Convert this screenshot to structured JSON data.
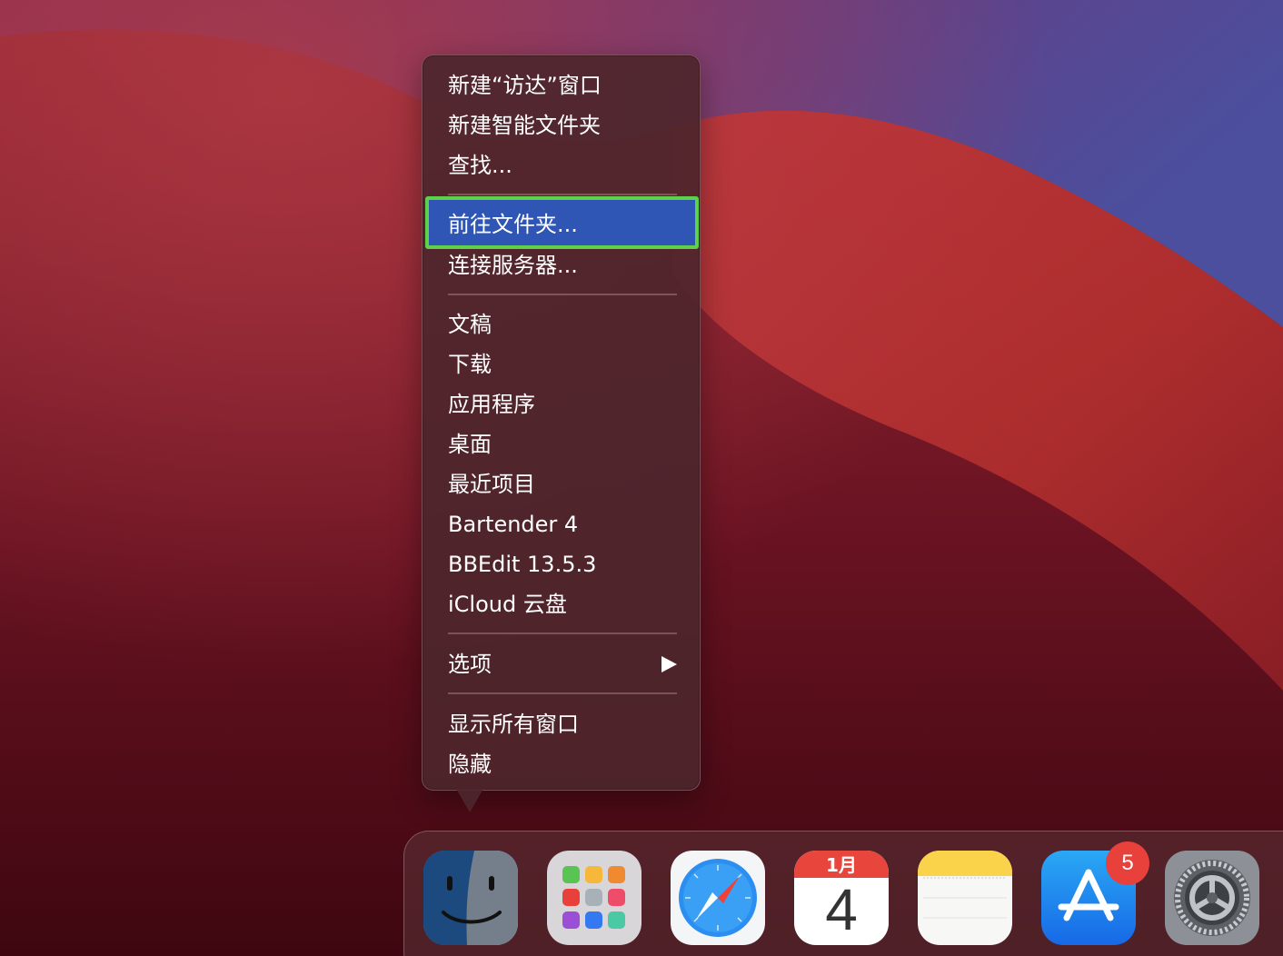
{
  "context_menu": {
    "items": [
      {
        "label": "新建“访达”窗口"
      },
      {
        "label": "新建智能文件夹"
      },
      {
        "label": "查找..."
      },
      {
        "label": "前往文件夹...",
        "highlighted": true
      },
      {
        "label": "连接服务器..."
      },
      {
        "label": "文稿"
      },
      {
        "label": "下载"
      },
      {
        "label": "应用程序"
      },
      {
        "label": "桌面"
      },
      {
        "label": "最近项目"
      },
      {
        "label": "Bartender 4"
      },
      {
        "label": "BBEdit 13.5.3"
      },
      {
        "label": "iCloud 云盘"
      },
      {
        "label": "选项",
        "submenu": true
      },
      {
        "label": "显示所有窗口"
      },
      {
        "label": "隐藏"
      }
    ],
    "highlight_color": "#2f56b4",
    "annotation_border_color": "#5fd04a"
  },
  "dock": {
    "apps": [
      {
        "name": "finder",
        "icon": "finder-icon"
      },
      {
        "name": "launchpad",
        "icon": "launchpad-icon"
      },
      {
        "name": "safari",
        "icon": "safari-icon"
      },
      {
        "name": "calendar",
        "icon": "calendar-icon",
        "month": "1月",
        "day": "4"
      },
      {
        "name": "notes",
        "icon": "notes-icon"
      },
      {
        "name": "app-store",
        "icon": "app-store-icon",
        "badge": "5"
      },
      {
        "name": "system-preferences",
        "icon": "gear-icon"
      }
    ]
  },
  "colors": {
    "wallpaper_red": "#b0242a",
    "wallpaper_dark": "#4a0a14",
    "wallpaper_purple": "#5a3c8a",
    "badge_red": "#e8403a"
  }
}
